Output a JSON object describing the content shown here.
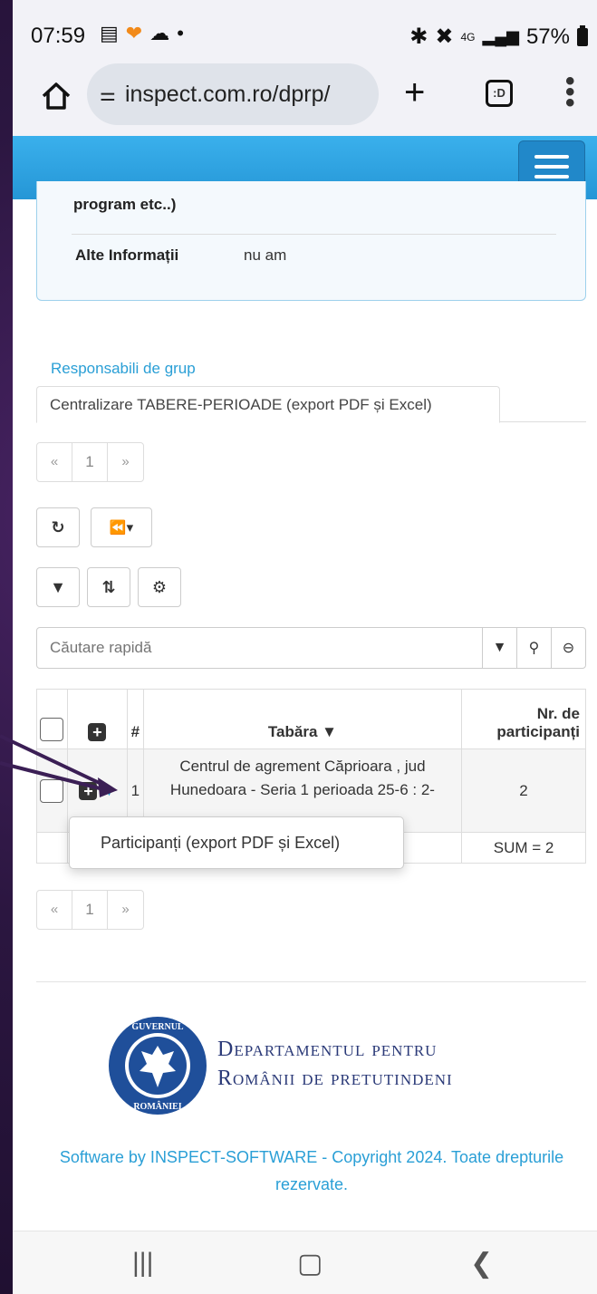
{
  "status": {
    "time": "07:59",
    "network": "4G",
    "battery": "57%"
  },
  "browser": {
    "url": "inspect.com.ro/dprp/"
  },
  "info_card": {
    "cut_text": "program etc..)",
    "label": "Alte Informații",
    "value": "nu am"
  },
  "links": {
    "responsabili": "Responsabili de grup"
  },
  "tab": {
    "label": "Centralizare TABERE-PERIOADE (export PDF și Excel)"
  },
  "pager": {
    "prev": "«",
    "page": "1",
    "next": "»"
  },
  "search": {
    "placeholder": "Căutare rapidă"
  },
  "table": {
    "headers": {
      "num": "#",
      "tabara": "Tabăra",
      "nr_participanti": "Nr. de participanți"
    },
    "rows": [
      {
        "index": "1",
        "tabara": "Centrul de agrement Căprioara , jud Hunedoara - Seria 1 perioada 25-6 : 2-",
        "participanti": "2"
      }
    ],
    "sum": "SUM = 2"
  },
  "dropdown": {
    "item": "Participanți (export PDF și Excel)"
  },
  "footer": {
    "dept_line1": "Departamentul pentru",
    "dept_line2": "Românii de pretutindeni",
    "copyright": "Software by INSPECT-SOFTWARE - Copyright 2024. Toate drepturile rezervate."
  },
  "colors": {
    "header_blue": "#2596d6",
    "link_blue": "#2a9fd6",
    "arrow": "#3b1f55"
  }
}
